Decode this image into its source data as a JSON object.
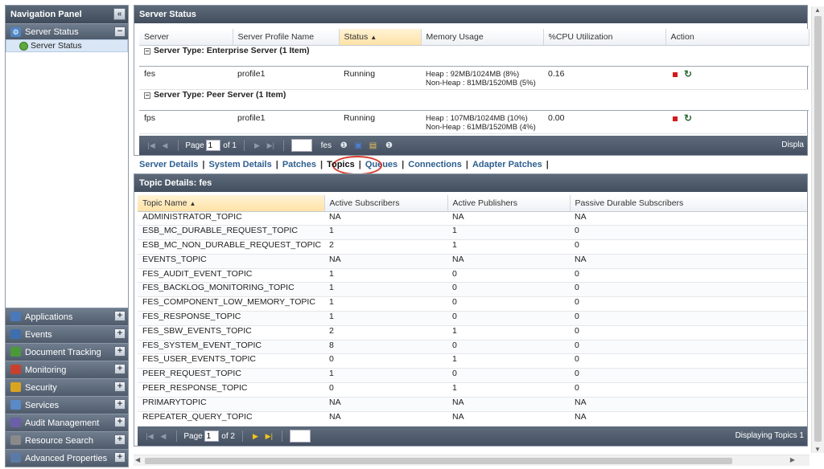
{
  "nav": {
    "title": "Navigation Panel",
    "collapse_icon": "double-chevron-left-icon",
    "server_status_section": "Server Status",
    "server_status_sub": "Server Status",
    "bottom_sections": [
      {
        "label": "Applications",
        "icon": "applications-icon",
        "color": "#4a78b8"
      },
      {
        "label": "Events",
        "icon": "events-icon",
        "color": "#3e6fb0"
      },
      {
        "label": "Document Tracking",
        "icon": "puzzle-icon",
        "color": "#4a9a3a"
      },
      {
        "label": "Monitoring",
        "icon": "monitoring-icon",
        "color": "#c8402e"
      },
      {
        "label": "Security",
        "icon": "lock-icon",
        "color": "#d9a520"
      },
      {
        "label": "Services",
        "icon": "gears-icon",
        "color": "#5a8ac8"
      },
      {
        "label": "Audit Management",
        "icon": "audit-icon",
        "color": "#6a5fa8"
      },
      {
        "label": "Resource Search",
        "icon": "magnifier-icon",
        "color": "#8a8a8a"
      },
      {
        "label": "Advanced Properties",
        "icon": "properties-icon",
        "color": "#5a7aa8"
      }
    ]
  },
  "server_panel": {
    "title": "Server Status",
    "columns": [
      "Server",
      "Server Profile Name",
      "Status",
      "Memory Usage",
      "%CPU Utilization",
      "Action"
    ],
    "groups": [
      {
        "label": "Server Type: Enterprise Server (1 Item)",
        "rows": [
          {
            "server": "fes",
            "profile": "profile1",
            "status": "Running",
            "heap": "Heap : 92MB/1024MB (8%)",
            "nonheap": "Non-Heap : 81MB/1520MB (5%)",
            "cpu": "0.16"
          }
        ]
      },
      {
        "label": "Server Type: Peer Server (1 Item)",
        "rows": [
          {
            "server": "fps",
            "profile": "profile1",
            "status": "Running",
            "heap": "Heap : 107MB/1024MB (10%)",
            "nonheap": "Non-Heap : 61MB/1520MB (4%)",
            "cpu": "0.00"
          }
        ]
      }
    ],
    "pager": {
      "page_label": "Page",
      "page_value": "1",
      "of_label": "of 1",
      "server_label": "fes",
      "display_text": "Displa"
    }
  },
  "tabs": [
    "Server Details",
    "System Details",
    "Patches",
    "Topics",
    "Queues",
    "Connections",
    "Adapter Patches"
  ],
  "active_tab": "Topics",
  "topic_panel": {
    "title": "Topic Details: fes",
    "columns": [
      "Topic Name",
      "Active Subscribers",
      "Active Publishers",
      "Passive Durable Subscribers"
    ],
    "rows": [
      [
        "ADMINISTRATOR_TOPIC",
        "NA",
        "NA",
        "NA"
      ],
      [
        "ESB_MC_DURABLE_REQUEST_TOPIC",
        "1",
        "1",
        "0"
      ],
      [
        "ESB_MC_NON_DURABLE_REQUEST_TOPIC",
        "2",
        "1",
        "0"
      ],
      [
        "EVENTS_TOPIC",
        "NA",
        "NA",
        "NA"
      ],
      [
        "FES_AUDIT_EVENT_TOPIC",
        "1",
        "0",
        "0"
      ],
      [
        "FES_BACKLOG_MONITORING_TOPIC",
        "1",
        "0",
        "0"
      ],
      [
        "FES_COMPONENT_LOW_MEMORY_TOPIC",
        "1",
        "0",
        "0"
      ],
      [
        "FES_RESPONSE_TOPIC",
        "1",
        "0",
        "0"
      ],
      [
        "FES_SBW_EVENTS_TOPIC",
        "2",
        "1",
        "0"
      ],
      [
        "FES_SYSTEM_EVENT_TOPIC",
        "8",
        "0",
        "0"
      ],
      [
        "FES_USER_EVENTS_TOPIC",
        "0",
        "1",
        "0"
      ],
      [
        "PEER_REQUEST_TOPIC",
        "1",
        "0",
        "0"
      ],
      [
        "PEER_RESPONSE_TOPIC",
        "0",
        "1",
        "0"
      ],
      [
        "PRIMARYTOPIC",
        "NA",
        "NA",
        "NA"
      ],
      [
        "REPEATER_QUERY_TOPIC",
        "NA",
        "NA",
        "NA"
      ]
    ],
    "pager": {
      "page_label": "Page",
      "page_value": "1",
      "of_label": "of 2",
      "display_text": "Displaying Topics 1"
    }
  }
}
